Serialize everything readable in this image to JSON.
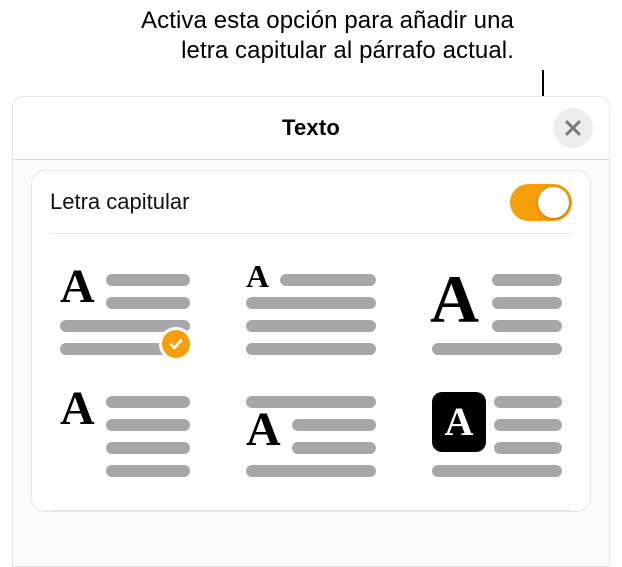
{
  "callout": {
    "line1": "Activa esta opción para añadir una",
    "line2": "letra capitular al párrafo actual."
  },
  "panel": {
    "title": "Texto",
    "setting_label": "Letra capitular",
    "switch_on": true,
    "accent_color": "#f59f0a"
  },
  "options": [
    {
      "id": "two-line-raised",
      "selected": true
    },
    {
      "id": "two-line-dropped",
      "selected": false
    },
    {
      "id": "three-line-large",
      "selected": false
    },
    {
      "id": "two-line-margin",
      "selected": false
    },
    {
      "id": "two-line-centered",
      "selected": false
    },
    {
      "id": "three-line-boxed",
      "selected": false
    }
  ]
}
